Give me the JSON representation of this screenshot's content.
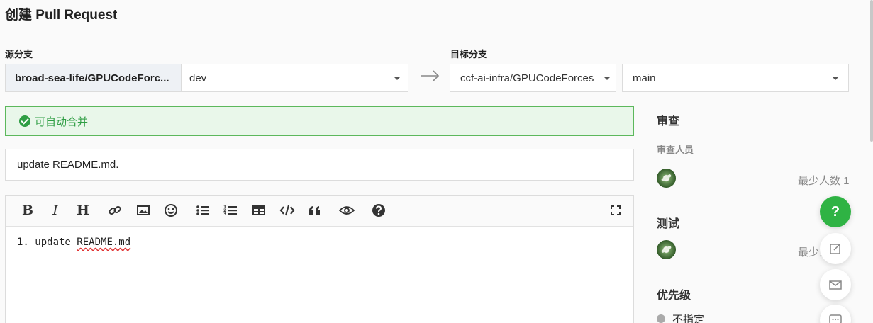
{
  "page": {
    "title": "创建 Pull Request"
  },
  "source": {
    "label": "源分支",
    "repo": "broad-sea-life/GPUCodeForc...",
    "branch": "dev"
  },
  "target": {
    "label": "目标分支",
    "repo": "ccf-ai-infra/GPUCodeForces",
    "branch": "main"
  },
  "merge_status": {
    "text": "可自动合并",
    "color": "#2f9e44"
  },
  "pr_title": {
    "value": "update README.md."
  },
  "editor": {
    "toolbar": [
      {
        "name": "bold-button",
        "icon": "bold-icon",
        "glyph": "B"
      },
      {
        "name": "italic-button",
        "icon": "italic-icon",
        "glyph": "I"
      },
      {
        "name": "heading-button",
        "icon": "heading-icon",
        "glyph": "H"
      },
      {
        "name": "link-button",
        "icon": "link-icon"
      },
      {
        "name": "image-button",
        "icon": "image-icon"
      },
      {
        "name": "emoji-button",
        "icon": "emoji-icon"
      },
      {
        "name": "bullet-list-button",
        "icon": "bullet-list-icon"
      },
      {
        "name": "numbered-list-button",
        "icon": "numbered-list-icon"
      },
      {
        "name": "table-button",
        "icon": "table-icon"
      },
      {
        "name": "code-button",
        "icon": "code-icon"
      },
      {
        "name": "quote-button",
        "icon": "quote-icon"
      },
      {
        "name": "preview-button",
        "icon": "eye-icon"
      },
      {
        "name": "help-button",
        "icon": "question-icon"
      },
      {
        "name": "fullscreen-button",
        "icon": "fullscreen-icon"
      }
    ],
    "content_prefix": "1. update ",
    "content_word": "README.md"
  },
  "sidebar": {
    "review": {
      "heading": "审查",
      "reviewers_label": "审查人员",
      "min_text": "最少人数 1"
    },
    "test": {
      "heading": "测试",
      "min_text": "最少人数 1"
    },
    "priority": {
      "heading": "优先级",
      "value": "不指定"
    }
  },
  "floating": {
    "help_glyph": "?",
    "accent": "#2fb344"
  }
}
